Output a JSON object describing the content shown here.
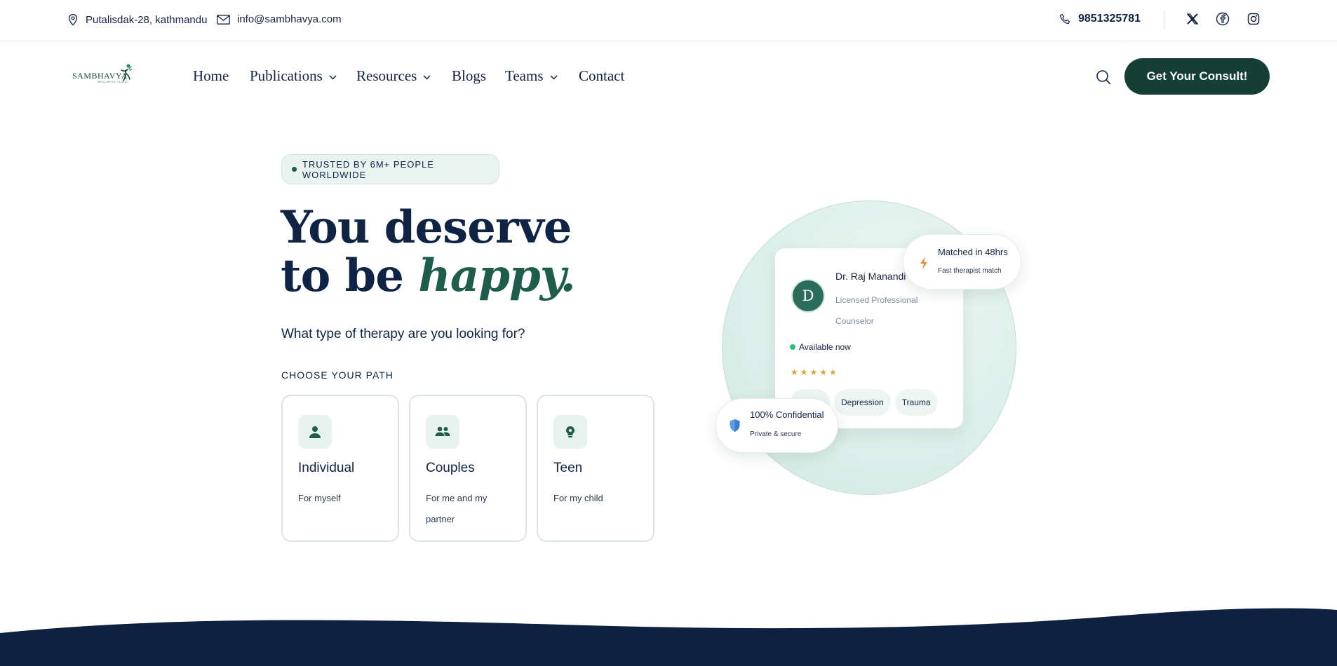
{
  "topbar": {
    "address": "Putalisdak-28, kathmandu",
    "email": "info@sambhavya.com",
    "phone": "9851325781",
    "social_icons": [
      "x-icon",
      "facebook-icon",
      "instagram-icon"
    ]
  },
  "brand": {
    "logo_word": "SAMBHAVYA",
    "logo_sub": "WELLNESS CLINIC"
  },
  "nav": {
    "items": [
      {
        "label": "Home",
        "has_dropdown": false
      },
      {
        "label": "Publications",
        "has_dropdown": true
      },
      {
        "label": "Resources",
        "has_dropdown": true
      },
      {
        "label": "Blogs",
        "has_dropdown": false
      },
      {
        "label": "Teams",
        "has_dropdown": true
      },
      {
        "label": "Contact",
        "has_dropdown": false
      }
    ],
    "cta_label": "Get Your Consult!"
  },
  "hero": {
    "badge": "TRUSTED BY 6M+ PEOPLE WORLDWIDE",
    "title_line1": "You deserve",
    "title_line2_prefix": "to be",
    "title_accent": "happy.",
    "subtitle": "What type of therapy are you looking for?",
    "path_label": "CHOOSE YOUR PATH",
    "paths": [
      {
        "title": "Individual",
        "subtitle": "For myself",
        "icon": "person-icon"
      },
      {
        "title": "Couples",
        "subtitle": "For me and my partner",
        "icon": "people-icon"
      },
      {
        "title": "Teen",
        "subtitle": "For my child",
        "icon": "lightbulb-head-icon"
      }
    ]
  },
  "profile": {
    "initial": "D",
    "name": "Dr. Raj Manandi",
    "role": "Licensed Professional Counselor",
    "status": "Available now",
    "rating": 5,
    "stars": "★★★★★",
    "tags": [
      "Depression",
      "Trauma"
    ]
  },
  "badges": {
    "match_title": "Matched in 48hrs",
    "match_sub": "Fast therapist match",
    "confidential_title": "100% Confidential",
    "confidential_sub": "Private & secure"
  },
  "colors": {
    "navy": "#0f2444",
    "brand_green": "#153e35",
    "accent_green": "#1e5c4c",
    "mint_bg": "#e9f4f1",
    "footer_navy": "#0e2140"
  }
}
